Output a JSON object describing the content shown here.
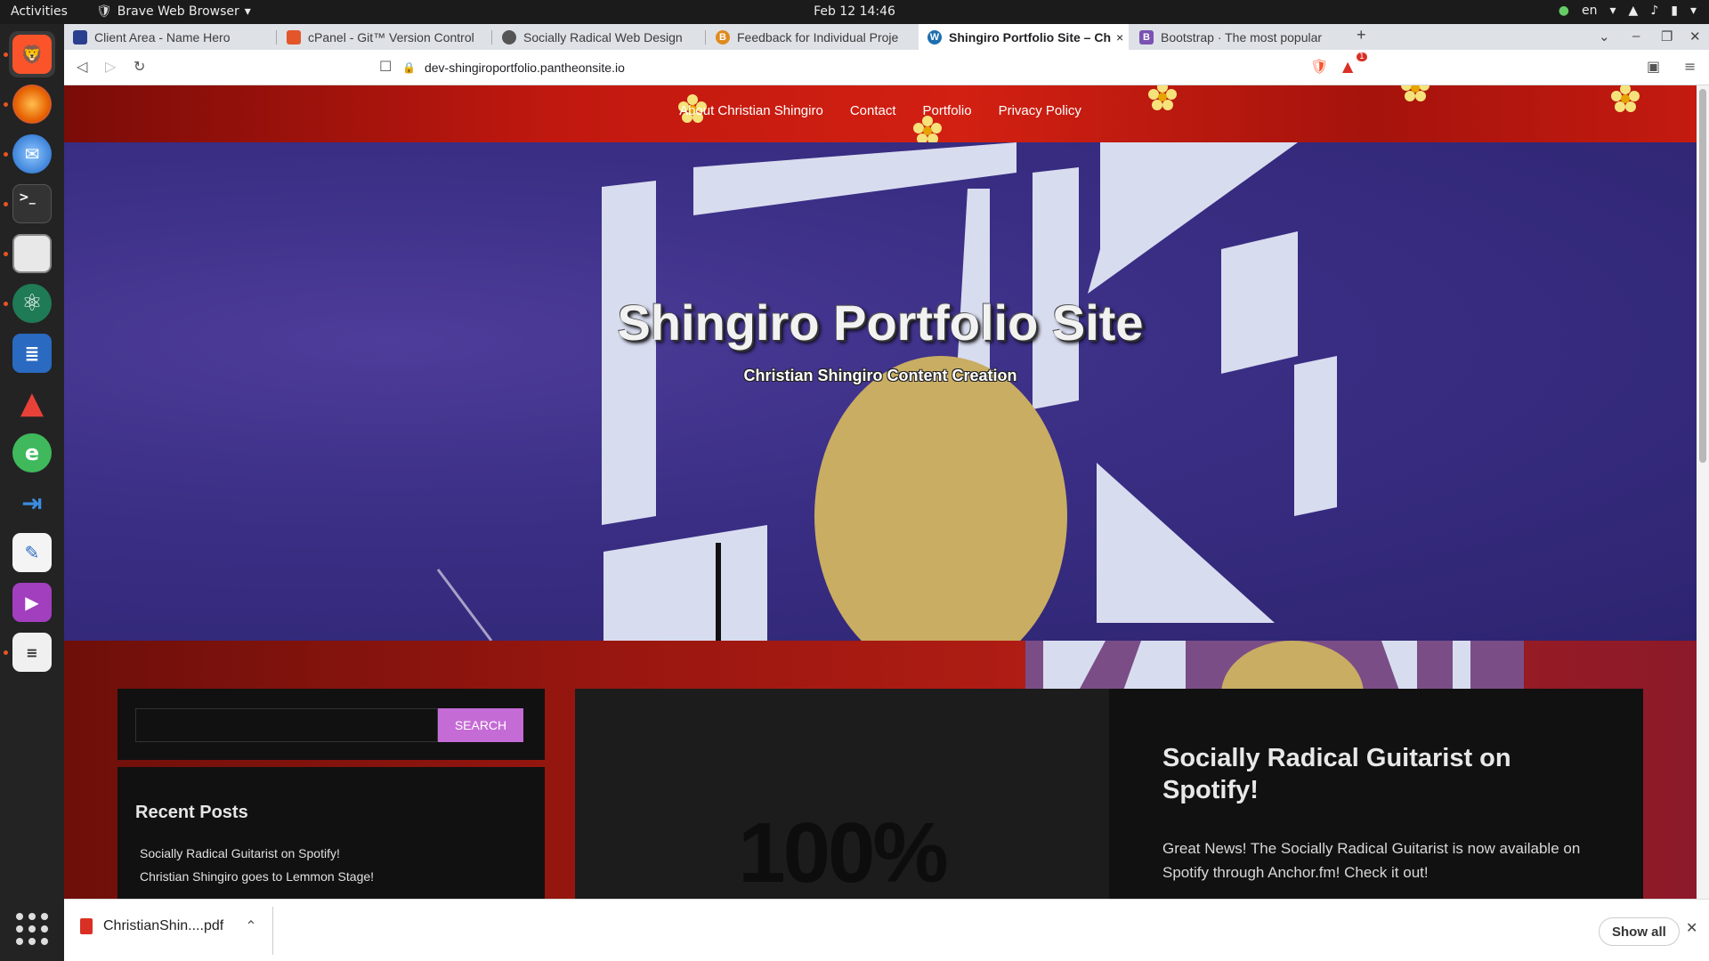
{
  "system": {
    "activities": "Activities",
    "app_menu": "Brave Web Browser",
    "clock": "Feb 12  14:46",
    "language": "en"
  },
  "browser": {
    "tabs": [
      {
        "label": "Client Area - Name Hero",
        "favicon_color": "#2a3f8f"
      },
      {
        "label": "cPanel - Git™ Version Control",
        "favicon_color": "#e3562a"
      },
      {
        "label": "Socially Radical Web Design",
        "favicon_color": "#555555"
      },
      {
        "label": "Feedback for Individual Proje",
        "favicon_color": "#e08a1e"
      },
      {
        "label": "Shingiro Portfolio Site – Ch",
        "favicon_color": "#1e6fb0"
      },
      {
        "label": "Bootstrap · The most popular",
        "favicon_color": "#7952b3"
      }
    ],
    "active_tab_close": "×",
    "new_tab": "+",
    "url": "dev-shingiroportfolio.pantheonsite.io",
    "brave_badge": "1"
  },
  "site": {
    "nav": [
      "About Christian Shingiro",
      "Contact",
      "Portfolio",
      "Privacy Policy"
    ],
    "title": "Shingiro Portfolio Site",
    "tagline": "Christian Shingiro Content Creation",
    "search_button": "SEARCH",
    "search_value": "",
    "recent_posts_title": "Recent Posts",
    "recent_posts": [
      "Socially Radical Guitarist on Spotify!",
      "Christian Shingiro goes to Lemmon Stage!"
    ],
    "post_image_text": "100%",
    "post_title": "Socially Radical Guitarist on Spotify!",
    "post_excerpt": "Great News! The Socially Radical Guitarist is now available on Spotify through Anchor.fm! Check it out!"
  },
  "downloads": {
    "file": "ChristianShin....pdf",
    "show_all": "Show all"
  },
  "colors": {
    "accent_search": "#c56bd6",
    "nav_red": "#c0180f",
    "hero_blue": "#3b2f86"
  }
}
